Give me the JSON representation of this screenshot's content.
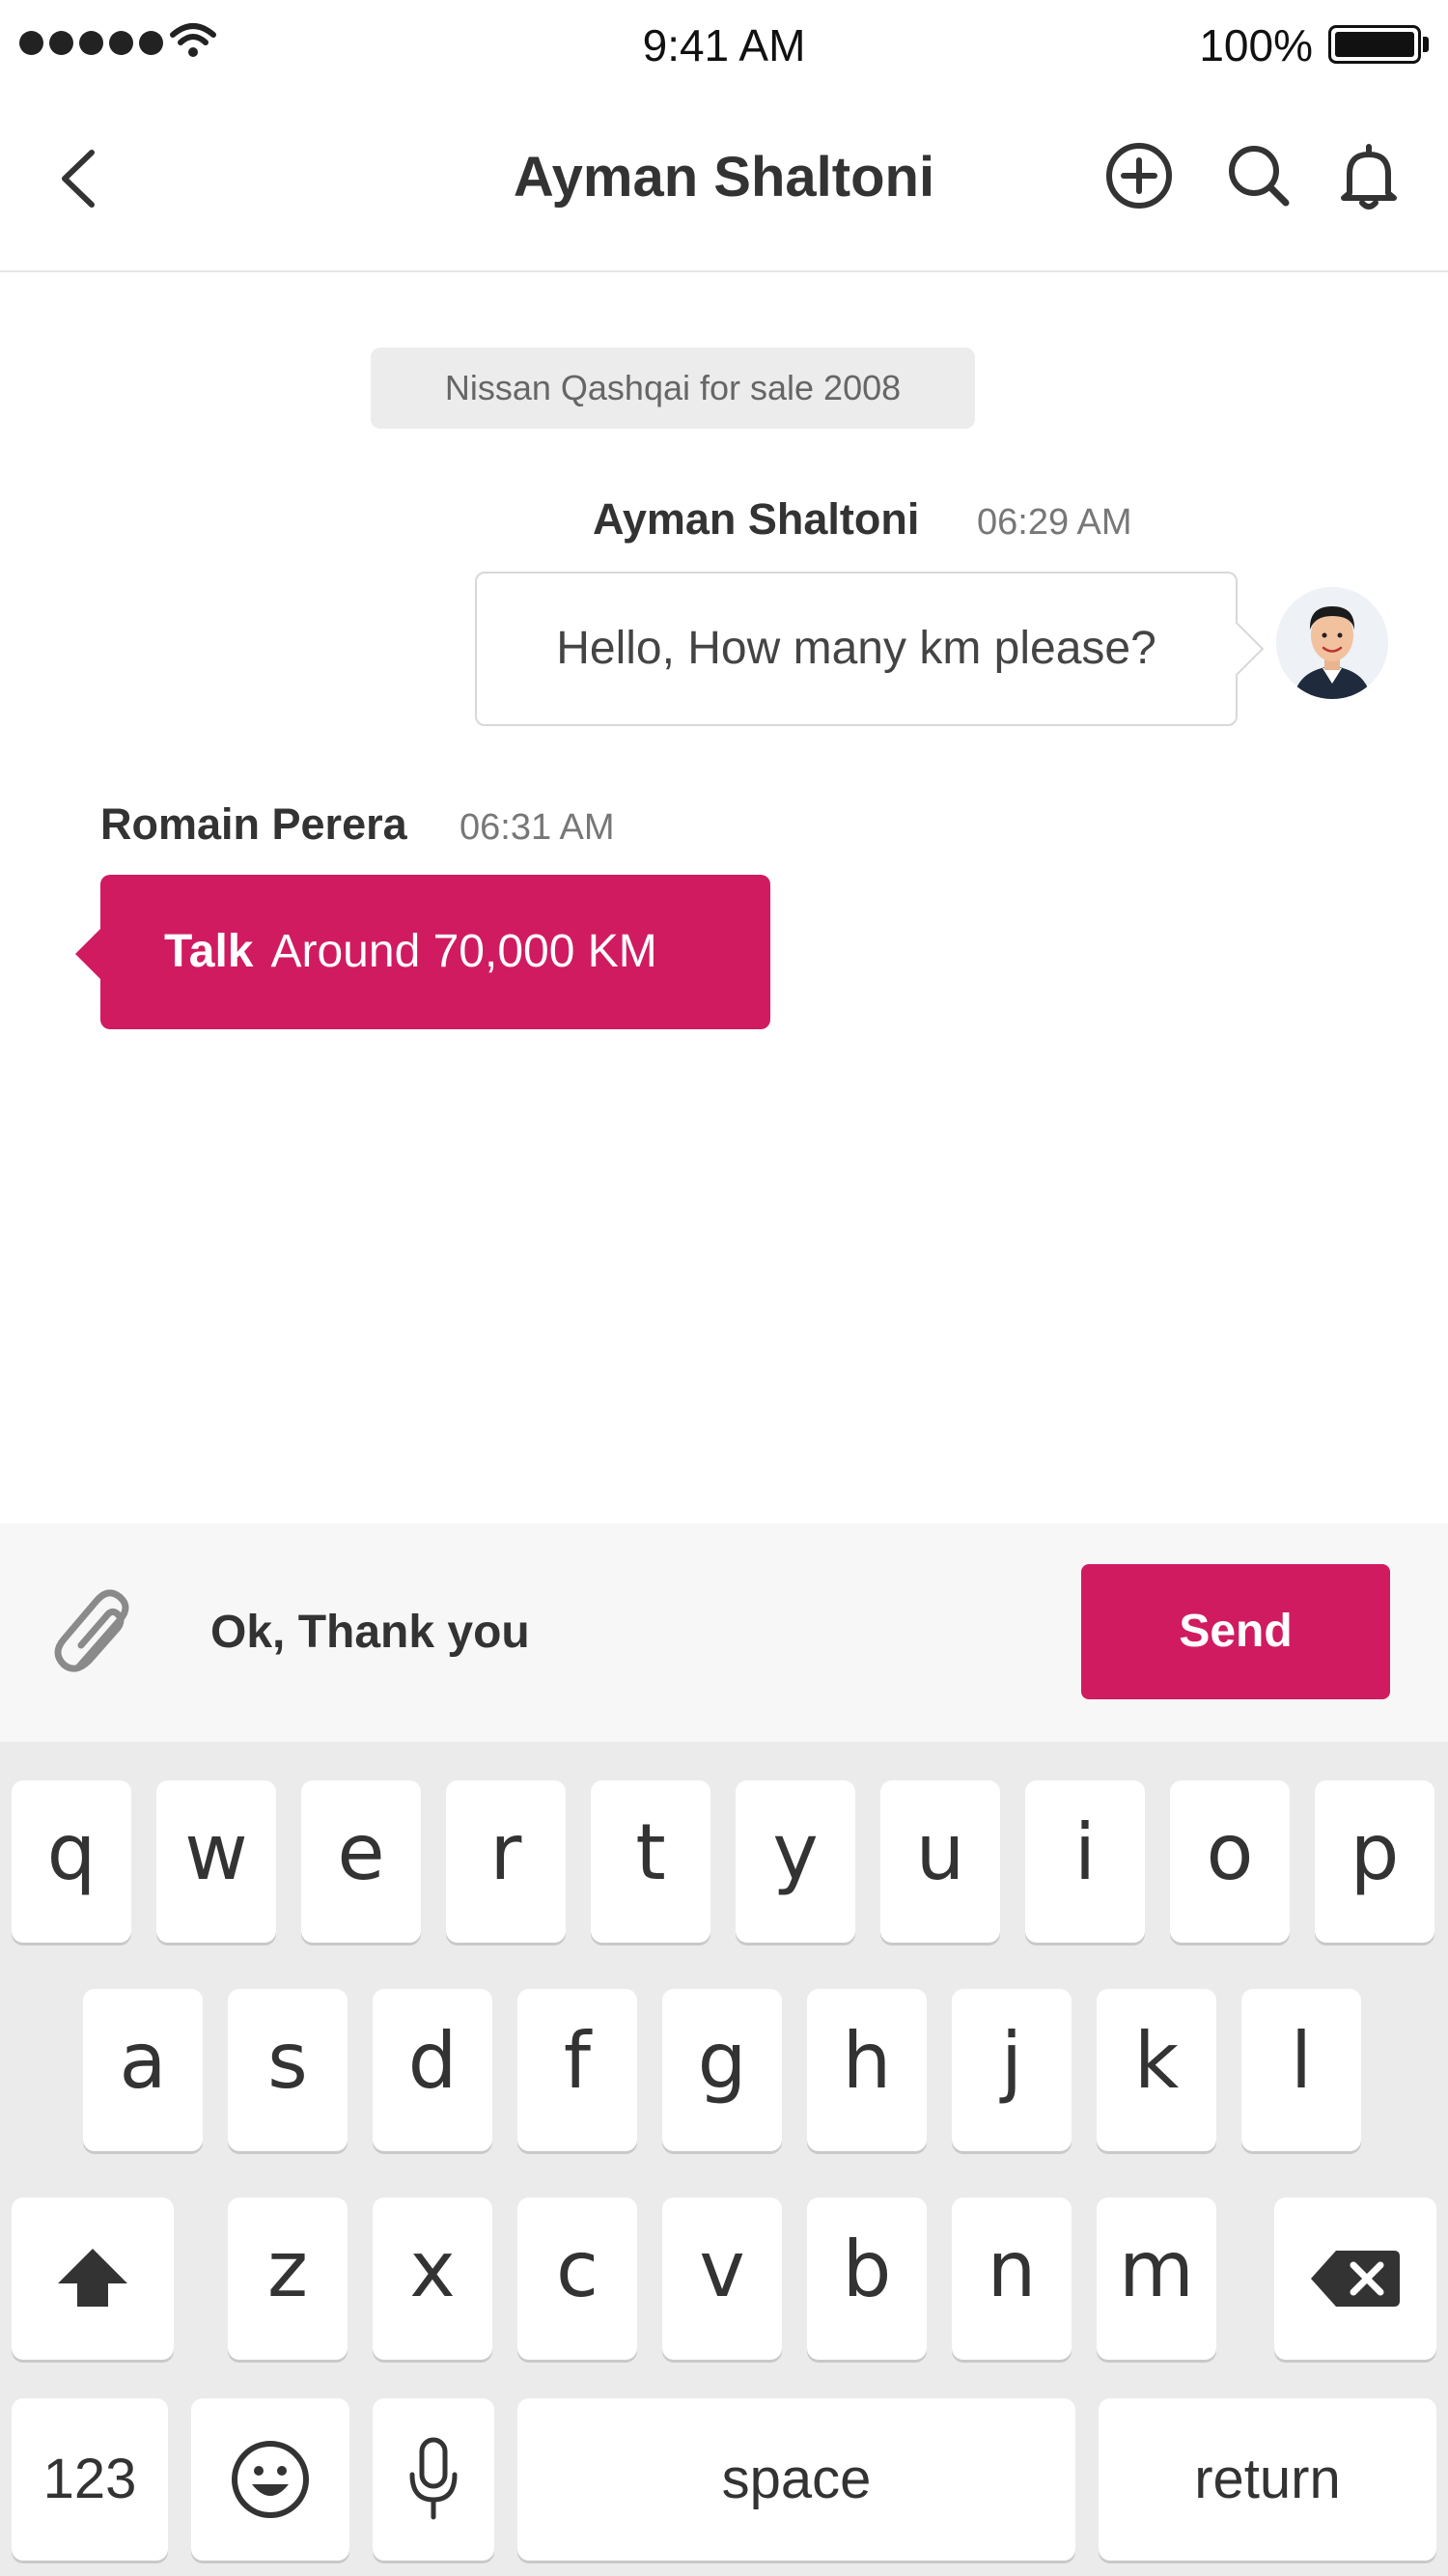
{
  "status_bar": {
    "time": "9:41 AM",
    "battery": "100%"
  },
  "nav": {
    "title": "Ayman Shaltoni"
  },
  "chat": {
    "topic": "Nissan Qashqai for sale 2008",
    "messages": [
      {
        "sender": "Ayman Shaltoni",
        "time": "06:29 AM",
        "text": "Hello, How many km please?"
      },
      {
        "sender": "Romain Perera",
        "time": "06:31 AM",
        "lead": "Talk",
        "text": "Around 70,000 KM"
      }
    ]
  },
  "composer": {
    "input_value": "Ok, Thank you",
    "send_label": "Send"
  },
  "keyboard": {
    "row1": [
      "q",
      "w",
      "e",
      "r",
      "t",
      "y",
      "u",
      "i",
      "o",
      "p"
    ],
    "row2": [
      "a",
      "s",
      "d",
      "f",
      "g",
      "h",
      "j",
      "k",
      "l"
    ],
    "row3": [
      "z",
      "x",
      "c",
      "v",
      "b",
      "n",
      "m"
    ],
    "numbers_label": "123",
    "space_label": "space",
    "return_label": "return"
  },
  "colors": {
    "accent": "#d01b61",
    "composer_bg": "#f7f7f7",
    "keyboard_bg": "#ebebeb"
  },
  "icons": [
    "signal-icon",
    "wifi-icon",
    "battery-icon",
    "back-icon",
    "add-icon",
    "search-icon",
    "bell-icon",
    "attach-icon",
    "shift-icon",
    "backspace-icon",
    "emoji-icon",
    "mic-icon"
  ]
}
